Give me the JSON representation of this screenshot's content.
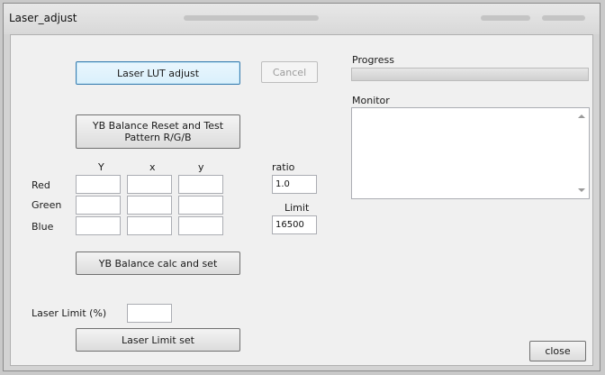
{
  "window": {
    "title": "Laser_adjust"
  },
  "buttons": {
    "laser_lut": "Laser LUT adjust",
    "cancel": "Cancel",
    "yb_reset": "YB Balance Reset and Test Pattern R/G/B",
    "yb_calc": "YB Balance calc and set",
    "laser_limit_set": "Laser Limit set",
    "close": "close"
  },
  "grid": {
    "headers": {
      "Y": "Y",
      "x": "x",
      "y": "y"
    },
    "rows": {
      "red": "Red",
      "green": "Green",
      "blue": "Blue"
    }
  },
  "ratio": {
    "label": "ratio",
    "value": "1.0"
  },
  "limit": {
    "label": "Limit",
    "value": "16500"
  },
  "laser_limit": {
    "label": "Laser Limit (%)",
    "value": ""
  },
  "progress": {
    "label": "Progress",
    "value": 0,
    "fill_color": "#06b025"
  },
  "monitor": {
    "label": "Monitor",
    "text": ""
  }
}
